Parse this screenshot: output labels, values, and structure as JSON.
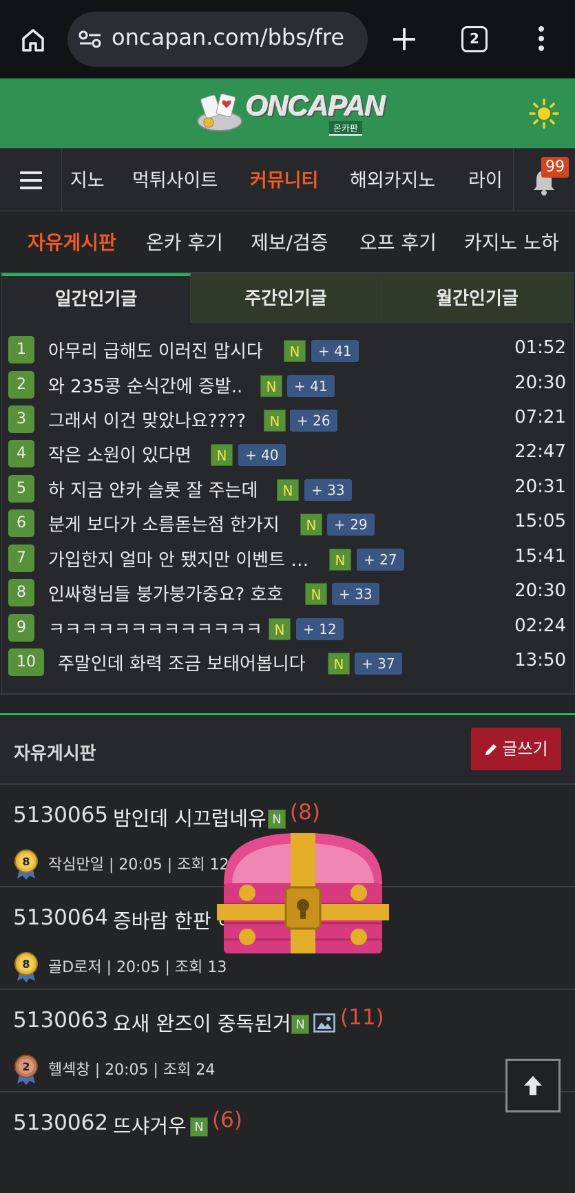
{
  "browser": {
    "url": "oncapan.com/bbs/fre",
    "tab_count": "2"
  },
  "site": {
    "logo_text": "ONCAPAN",
    "logo_sub": "온카판"
  },
  "nav": {
    "items": [
      "지노",
      "먹튀사이트",
      "커뮤니티",
      "해외카지노",
      "라이"
    ],
    "active": "커뮤니티",
    "notification_count": "99"
  },
  "subnav": {
    "items": [
      "자유게시판",
      "온카 후기",
      "제보/검증",
      "오프 후기",
      "카지노 노하"
    ],
    "active": "자유게시판"
  },
  "popular": {
    "tabs": [
      "일간인기글",
      "주간인기글",
      "월간인기글"
    ],
    "rows": [
      {
        "rank": "1",
        "title": "아무리 급해도 이러진 맙시다",
        "n": "N",
        "count": "+ 41",
        "time": "01:52"
      },
      {
        "rank": "2",
        "title": "와 235콩 순식간에 증발..",
        "n": "N",
        "count": "+ 41",
        "time": "20:30"
      },
      {
        "rank": "3",
        "title": "그래서 이건 맞았나요????",
        "n": "N",
        "count": "+ 26",
        "time": "07:21"
      },
      {
        "rank": "4",
        "title": "작은 소원이 있다면",
        "n": "N",
        "count": "+ 40",
        "time": "22:47"
      },
      {
        "rank": "5",
        "title": "하 지금 얀카 슬롯 잘 주는데",
        "n": "N",
        "count": "+ 33",
        "time": "20:31"
      },
      {
        "rank": "6",
        "title": "분게 보다가 소름돋는점 한가지",
        "n": "N",
        "count": "+ 29",
        "time": "15:05"
      },
      {
        "rank": "7",
        "title": "가입한지 얼마 안 됐지만 이벤트 …",
        "n": "N",
        "count": "+ 27",
        "time": "15:41"
      },
      {
        "rank": "8",
        "title": "인싸형님들 붕가붕가중요? 호호",
        "n": "N",
        "count": "+ 33",
        "time": "20:30"
      },
      {
        "rank": "9",
        "title": "ㅋㅋㅋㅋㅋㅋㅋㅋㅋㅋㅋㅋㅋ",
        "n": "N",
        "count": "+ 12",
        "time": "02:24"
      },
      {
        "rank": "10",
        "title": "주말인데 화력 조금 보태어봅니다",
        "n": "N",
        "count": "+ 37",
        "time": "13:50"
      }
    ]
  },
  "board": {
    "title": "자유게시판",
    "write_label": "글쓰기",
    "posts": [
      {
        "id": "5130065",
        "title": "밤인데 시끄럽네유",
        "n": "N",
        "count": "(8)",
        "level": "8",
        "meta": "작심만일 | 20:05 | 조회 12"
      },
      {
        "id": "5130064",
        "title": "증바람 한판 하",
        "n": "",
        "count": "",
        "level": "8",
        "meta": "골D로저 | 20:05 | 조회 13"
      },
      {
        "id": "5130063",
        "title": "요새 완즈이 중독된거",
        "n": "N",
        "count": "(11)",
        "level": "2",
        "meta": "헬섹창 | 20:05 | 조회 24"
      },
      {
        "id": "5130062",
        "title": "뜨샤거우",
        "n": "N",
        "count": "(6)",
        "level": "",
        "meta": ""
      }
    ]
  },
  "colors": {
    "brand_green": "#2f9253",
    "accent_orange": "#ec5a24",
    "write_red": "#a31b2b"
  }
}
